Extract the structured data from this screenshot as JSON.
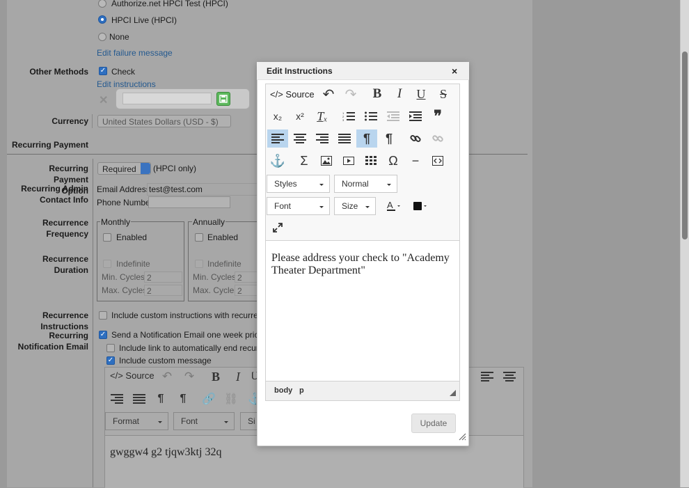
{
  "payment": {
    "options": [
      {
        "label": "Authorize.net HPCI Test (HPCI)",
        "selected": false
      },
      {
        "label": "HPCI Live (HPCI)",
        "selected": true
      },
      {
        "label": "None",
        "selected": false
      }
    ],
    "edit_failure_link": "Edit failure message"
  },
  "other_methods": {
    "label": "Other Methods",
    "check_label": "Check",
    "check_checked": true,
    "edit_instructions_link": "Edit instructions"
  },
  "currency": {
    "label": "Currency",
    "value": "United States Dollars (USD - $)"
  },
  "recurring": {
    "section_title": "Recurring Payment",
    "option_label_1": "Recurring Payment",
    "option_label_2": "Option",
    "option_value": "Required",
    "option_note": "(HPCI only)",
    "admin_label_1": "Recurring Admin",
    "admin_label_2": "Contact Info",
    "email_label": "Email Address",
    "email_value": "test@test.com",
    "phone_label": "Phone Number",
    "phone_value": "",
    "frequency_label_1": "Recurrence",
    "frequency_label_2": "Frequency",
    "duration_label": "Recurrence Duration",
    "monthly": {
      "title": "Monthly",
      "enabled": "Enabled",
      "indefinite": "Indefinite",
      "min_label": "Min. Cycles",
      "min_value": "2",
      "max_label": "Max. Cycles",
      "max_value": "2"
    },
    "annually": {
      "title": "Annually",
      "enabled": "Enabled",
      "indefinite": "Indefinite",
      "min_label": "Min. Cycles",
      "min_value": "2",
      "max_label": "Max. Cycles",
      "max_value": "2"
    },
    "instructions_label_1": "Recurrence",
    "instructions_label_2": "Instructions",
    "instructions_option": "Include custom instructions with recurrence",
    "notif_label_1": "Recurring",
    "notif_label_2": "Notification Email",
    "notif_send": "Send a Notification Email one week prior to",
    "notif_link_option": "Include link to automatically end recurring",
    "notif_custom": "Include custom message"
  },
  "bg_editor": {
    "source": "Source",
    "format": "Format",
    "font": "Font",
    "size": "Si",
    "content": "gwggw4 g2 tjqw3ktj 32q"
  },
  "modal": {
    "title": "Edit Instructions",
    "close": "×",
    "source": "Source",
    "styles": "Styles",
    "format": "Normal",
    "font": "Font",
    "size": "Size",
    "content": "Please address your check to \"Academy Theater Department\"",
    "path_body": "body",
    "path_p": "p",
    "update": "Update"
  }
}
